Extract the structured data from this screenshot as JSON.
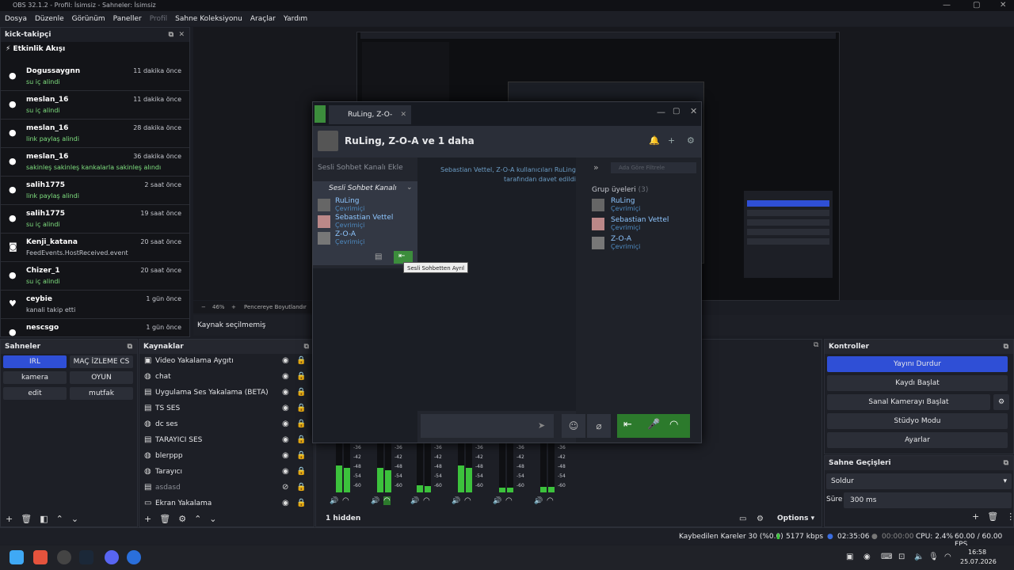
{
  "window": {
    "title": "OBS 32.1.2 - Profil: İsimsiz - Sahneler: İsimsiz"
  },
  "menu": [
    "Dosya",
    "Düzenle",
    "Görünüm",
    "Paneller",
    "Profil",
    "Sahne Koleksiyonu",
    "Araçlar",
    "Yardım"
  ],
  "kick_dock": {
    "title": "kick-takipçi",
    "section": "Etkinlik Akışı",
    "events": [
      {
        "name": "Dogussaygnn",
        "time": "11 dakika önce",
        "action": "su iç alindi",
        "icon": "gift-icon",
        "green": true
      },
      {
        "name": "meslan_16",
        "time": "11 dakika önce",
        "action": "su iç alindi",
        "icon": "gift-icon",
        "green": true
      },
      {
        "name": "meslan_16",
        "time": "28 dakika önce",
        "action": "link paylaş alindi",
        "icon": "gift-icon",
        "green": true
      },
      {
        "name": "meslan_16",
        "time": "36 dakika önce",
        "action": "sakinleş sakinleş kankalarla sakinleş alındı",
        "icon": "gift-icon",
        "green": true
      },
      {
        "name": "salih1775",
        "time": "2 saat önce",
        "action": "link paylaş alindi",
        "icon": "gift-icon",
        "green": true
      },
      {
        "name": "salih1775",
        "time": "19 saat önce",
        "action": "su iç alindi",
        "icon": "gift-icon",
        "green": true
      },
      {
        "name": "Kenji_katana",
        "time": "20 saat önce",
        "action": "FeedEvents.HostReceived.event",
        "icon": "host-icon",
        "green": false
      },
      {
        "name": "Chizer_1",
        "time": "20 saat önce",
        "action": "su iç alindi",
        "icon": "gift-icon",
        "green": true
      },
      {
        "name": "ceybie",
        "time": "1 gün önce",
        "action": "kanali takip etti",
        "icon": "heart-icon",
        "green": false
      },
      {
        "name": "nescsgo",
        "time": "1 gün önce",
        "action": "",
        "icon": "gift-icon",
        "green": false
      }
    ]
  },
  "preview": {
    "zoom": "46%",
    "fit_label": "Pencereye Boyutlandır",
    "no_source": "Kaynak seçilmemiş"
  },
  "scenes": {
    "title": "Sahneler",
    "items": [
      "IRL",
      "MAÇ İZLEME CS",
      "kamera",
      "OYUN",
      "edit",
      "mutfak"
    ]
  },
  "sources": {
    "title": "Kaynaklar",
    "items": [
      {
        "label": "Video Yakalama Aygıtı",
        "hidden": false
      },
      {
        "label": "chat",
        "hidden": false
      },
      {
        "label": "Uygulama Ses Yakalama (BETA)",
        "hidden": false
      },
      {
        "label": "TS SES",
        "hidden": false
      },
      {
        "label": "dc ses",
        "hidden": false
      },
      {
        "label": "TARAYICI SES",
        "hidden": false
      },
      {
        "label": "blerppp",
        "hidden": false
      },
      {
        "label": "Tarayıcı",
        "hidden": false
      },
      {
        "label": "asdasd",
        "hidden": true
      },
      {
        "label": "Ekran Yakalama",
        "hidden": false
      }
    ]
  },
  "mixer": {
    "hidden_label": "1 hidden",
    "options": "Options",
    "ticks": [
      "-36",
      "-42",
      "-48",
      "-54",
      "-60"
    ]
  },
  "controls": {
    "title": "Kontroller",
    "buttons": [
      "Yayını Durdur",
      "Kaydı Başlat",
      "Sanal Kamerayı Başlat",
      "Stüdyo Modu",
      "Ayarlar"
    ]
  },
  "transitions": {
    "title": "Sahne Geçişleri",
    "selected": "Soldur",
    "duration_label": "Süre",
    "duration": "300 ms"
  },
  "steam": {
    "tab": "RuLing, Z-O-",
    "header_title": "RuLing, Z-O-A ve 1 daha",
    "voice_add": "Sesli Sohbet Kanalı Ekle",
    "voice_channel": "Sesli Sohbet Kanalı",
    "voice_members": [
      {
        "name": "RuLing",
        "status": "Çevrimiçi"
      },
      {
        "name": "Sebastian Vettel",
        "status": "Çevrimiçi"
      },
      {
        "name": "Z-O-A",
        "status": "Çevrimiçi"
      }
    ],
    "tooltip": "Sesli Sohbetten Ayrıl",
    "message": "Sebastian Vettel, Z-O-A kullanıcıları RuLing tarafından davet edildi",
    "filter_placeholder": "Ada Göre Filtrele",
    "group_title": "Grup üyeleri",
    "group_count": "(3)",
    "group_members": [
      {
        "name": "RuLing",
        "status": "Çevrimiçi"
      },
      {
        "name": "Sebastian Vettel",
        "status": "Çevrimiçi"
      },
      {
        "name": "Z-O-A",
        "status": "Çevrimiçi"
      }
    ]
  },
  "status": {
    "dropped": "Kaybedilen Kareler 30 (%0.0)",
    "bitrate": "5177 kbps",
    "live_time": "02:35:06",
    "rec_time": "00:00:00",
    "cpu": "CPU: 2.4%",
    "fps": "60.00 / 60.00 FPS"
  },
  "taskbar": {
    "time": "16:58",
    "date": "25.07.2026"
  }
}
